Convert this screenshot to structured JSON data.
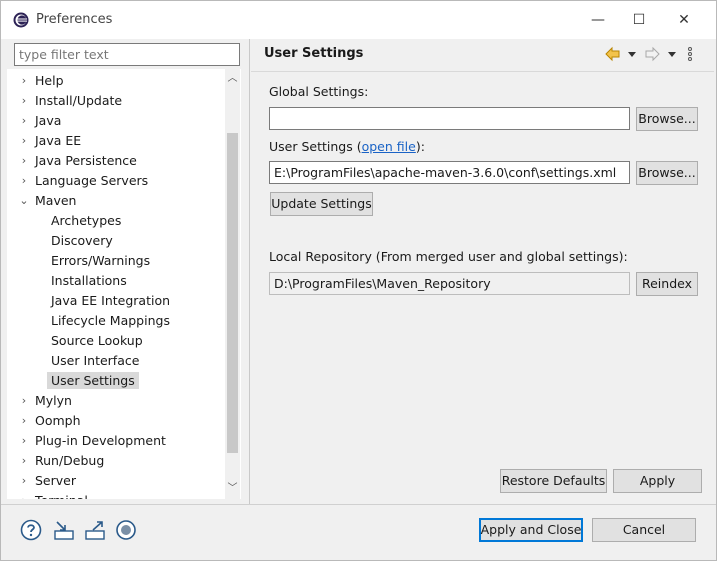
{
  "window": {
    "title": "Preferences",
    "minimize": "—",
    "maximize": "☐",
    "close": "✕"
  },
  "filter": {
    "placeholder": "type filter text"
  },
  "tree": {
    "items": [
      {
        "label": "Help",
        "expander": "›",
        "indent": 0
      },
      {
        "label": "Install/Update",
        "expander": "›",
        "indent": 0
      },
      {
        "label": "Java",
        "expander": "›",
        "indent": 0
      },
      {
        "label": "Java EE",
        "expander": "›",
        "indent": 0
      },
      {
        "label": "Java Persistence",
        "expander": "›",
        "indent": 0
      },
      {
        "label": "Language Servers",
        "expander": "›",
        "indent": 0
      },
      {
        "label": "Maven",
        "expander": "⌄",
        "indent": 0
      },
      {
        "label": "Archetypes",
        "expander": "",
        "indent": 1
      },
      {
        "label": "Discovery",
        "expander": "",
        "indent": 1
      },
      {
        "label": "Errors/Warnings",
        "expander": "",
        "indent": 1
      },
      {
        "label": "Installations",
        "expander": "",
        "indent": 1
      },
      {
        "label": "Java EE Integration",
        "expander": "",
        "indent": 1
      },
      {
        "label": "Lifecycle Mappings",
        "expander": "",
        "indent": 1
      },
      {
        "label": "Source Lookup",
        "expander": "",
        "indent": 1
      },
      {
        "label": "User Interface",
        "expander": "",
        "indent": 1
      },
      {
        "label": "User Settings",
        "expander": "",
        "indent": 1,
        "selected": true
      },
      {
        "label": "Mylyn",
        "expander": "›",
        "indent": 0
      },
      {
        "label": "Oomph",
        "expander": "›",
        "indent": 0
      },
      {
        "label": "Plug-in Development",
        "expander": "›",
        "indent": 0
      },
      {
        "label": "Run/Debug",
        "expander": "›",
        "indent": 0
      },
      {
        "label": "Server",
        "expander": "›",
        "indent": 0
      },
      {
        "label": "Terminal",
        "expander": "›",
        "indent": 0
      }
    ]
  },
  "page": {
    "title": "User Settings",
    "global_settings_label": "Global Settings:",
    "global_settings_value": "",
    "browse_label": "Browse...",
    "user_settings_label": "User Settings (",
    "open_file_link": "open file",
    "user_settings_label_end": "):",
    "user_settings_value": "E:\\ProgramFiles\\apache-maven-3.6.0\\conf\\settings.xml",
    "update_settings_label": "Update Settings",
    "local_repo_label": "Local Repository (From merged user and global settings):",
    "local_repo_value": "D:\\ProgramFiles\\Maven_Repository",
    "reindex_label": "Reindex",
    "restore_defaults_label": "Restore Defaults",
    "apply_label": "Apply"
  },
  "footer": {
    "apply_close_label": "Apply and Close",
    "cancel_label": "Cancel"
  },
  "colors": {
    "accent": "#0078d7",
    "link": "#1a63c6",
    "nav_arrow": "#d09b00"
  }
}
